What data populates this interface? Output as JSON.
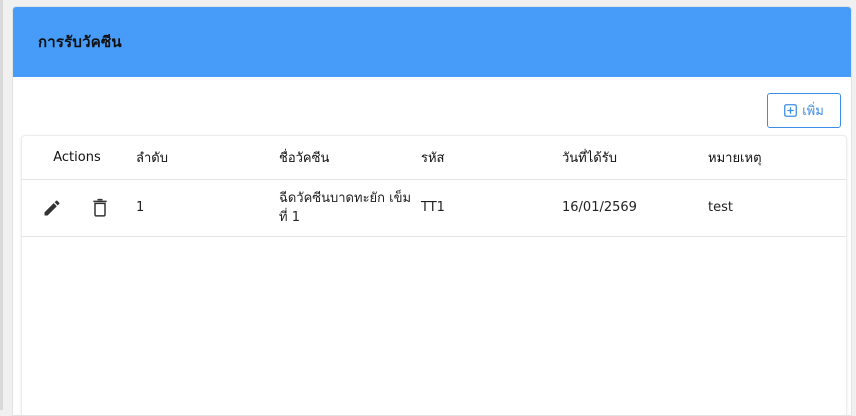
{
  "card": {
    "title": "การรับวัคซีน",
    "header_color": "#469cf8"
  },
  "toolbar": {
    "add_label": "เพิ่ม",
    "add_icon": "plus-square-icon",
    "accent_color": "#3b8ee8"
  },
  "table": {
    "columns": [
      "Actions",
      "ลำดับ",
      "ชื่อวัคซีน",
      "รหัส",
      "วันที่ได้รับ",
      "หมายเหตุ"
    ],
    "rows": [
      {
        "actions": [
          "edit-icon",
          "delete-icon"
        ],
        "order": "1",
        "name": "ฉีดวัคซีนบาดทะยัก เข็มที่ 1",
        "code": "TT1",
        "date": "16/01/2569",
        "note": "test"
      }
    ]
  }
}
